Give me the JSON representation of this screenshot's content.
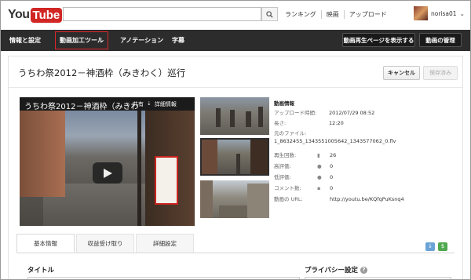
{
  "header": {
    "logo_you": "You",
    "logo_tube": "Tube",
    "links": [
      "ランキング",
      "映画",
      "アップロード"
    ],
    "username": "norisa01",
    "username_chevron": "⌄"
  },
  "nav": {
    "items": [
      "情報と設定",
      "動画加工ツール",
      "アノテーション",
      "字幕"
    ],
    "active_index": 1,
    "right_buttons": [
      "動画再生ページを表示する",
      "動画の管理"
    ]
  },
  "editor": {
    "video_title": "うちわ祭2012－神酒枠（みきわく）巡行",
    "cancel_label": "キャンセル",
    "save_label": "保存済み"
  },
  "player": {
    "overlay_title": "うちわ祭2012－神酒枠（みきわ",
    "share_label": "共有",
    "details_label": "詳細情報"
  },
  "info": {
    "heading": "動画情報",
    "upload_label": "アップロード時間:",
    "upload_value": "2012/07/29 08:52",
    "length_label": "長さ:",
    "length_value": "12:20",
    "file_label": "元のファイル:",
    "file_value": "1_8632455_1343551005642_1343577062_0.flv",
    "views_label": "再生回数:",
    "views_value": "26",
    "likes_label": "高評価:",
    "likes_value": "0",
    "dislikes_label": "低評価:",
    "dislikes_value": "0",
    "comments_label": "コメント数:",
    "comments_value": "0",
    "url_label": "動画の URL:",
    "url_value": "http://youtu.be/KQfqPuKsnq4"
  },
  "tabs": {
    "items": [
      "基本情報",
      "収益受け取り",
      "詳細設定"
    ],
    "active_index": 0,
    "icon_a": "↓",
    "icon_b": "$"
  },
  "form": {
    "title_label": "タイトル",
    "privacy_label": "プライバシー設定",
    "help_glyph": "?"
  },
  "colors": {
    "youtube_red": "#d12624",
    "nav_bg": "#2c2c2c",
    "active_outline": "#e0262a"
  }
}
